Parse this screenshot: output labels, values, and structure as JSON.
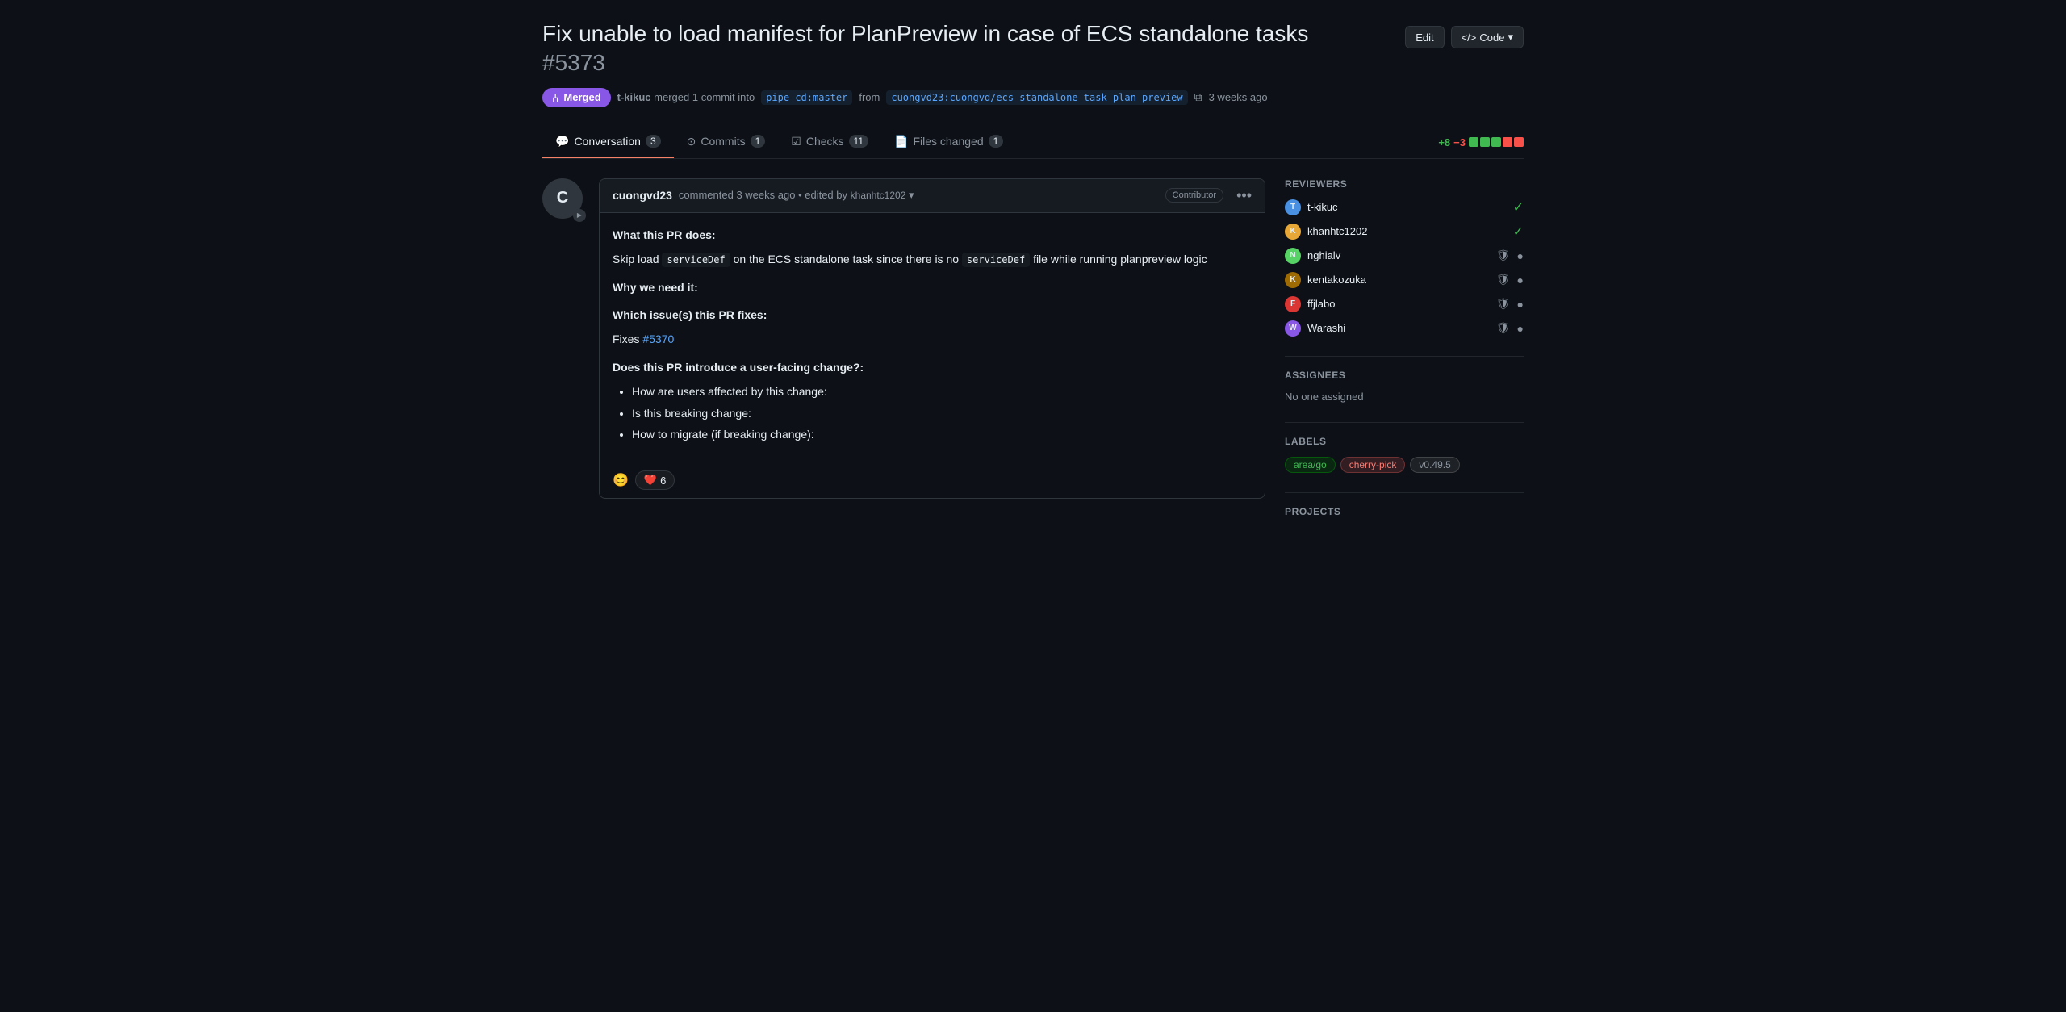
{
  "page": {
    "title": "Fix unable to load manifest for PlanPreview in case of ECS standalone tasks",
    "pr_number": "#5373",
    "merged_badge": "Merged",
    "edit_label": "Edit",
    "code_label": "Code",
    "merged_by": "t-kikuc",
    "merged_action": "merged",
    "commit_count": "1 commit",
    "merged_into": "into",
    "branch_from": "pipe-cd:master",
    "merged_from": "from",
    "branch_head": "cuongvd23:cuongvd/ecs-standalone-task-plan-preview",
    "time_ago": "3 weeks ago"
  },
  "tabs": [
    {
      "id": "conversation",
      "label": "Conversation",
      "count": "3",
      "active": true,
      "icon": "💬"
    },
    {
      "id": "commits",
      "label": "Commits",
      "count": "1",
      "active": false,
      "icon": "⊙"
    },
    {
      "id": "checks",
      "label": "Checks",
      "count": "11",
      "active": false,
      "icon": "☑"
    },
    {
      "id": "files-changed",
      "label": "Files changed",
      "count": "1",
      "active": false,
      "icon": "📄"
    }
  ],
  "diff_stats": {
    "plus": "+8",
    "minus": "−3",
    "squares": [
      "green",
      "green",
      "green",
      "red",
      "red"
    ]
  },
  "comment": {
    "author": "cuongvd23",
    "action": "commented",
    "time_ago": "3 weeks ago",
    "edited_prefix": "• edited by",
    "edited_by": "khanhtc1202",
    "role_badge": "Contributor",
    "body": {
      "section1_title": "What this PR does:",
      "section1_text": "Skip load",
      "code1": "serviceDef",
      "section1_text2": "on the ECS standalone task since there is no",
      "code2": "serviceDef",
      "section1_text3": "file while running planpreview logic",
      "section2_title": "Why we need it:",
      "section3_title": "Which issue(s) this PR fixes:",
      "fixes_text": "Fixes",
      "fixes_link": "#5370",
      "section4_title": "Does this PR introduce a user-facing change?:",
      "bullets": [
        "How are users affected by this change:",
        "Is this breaking change:",
        "How to migrate (if breaking change):"
      ]
    },
    "reactions": {
      "add_icon": "😊",
      "heart_emoji": "❤️",
      "heart_count": "6"
    }
  },
  "sidebar": {
    "reviewers_title": "Reviewers",
    "reviewers": [
      {
        "name": "t-kikuc",
        "status": "approved",
        "shield": false
      },
      {
        "name": "khanhtc1202",
        "status": "approved",
        "shield": false
      },
      {
        "name": "nghialv",
        "status": "pending",
        "shield": true
      },
      {
        "name": "kentakozuka",
        "status": "pending",
        "shield": true
      },
      {
        "name": "ffjlabo",
        "status": "pending",
        "shield": true
      },
      {
        "name": "Warashi",
        "status": "pending",
        "shield": true
      }
    ],
    "assignees_title": "Assignees",
    "no_assignees": "No one assigned",
    "labels_title": "Labels",
    "labels": [
      {
        "text": "area/go",
        "style": "area-go"
      },
      {
        "text": "cherry-pick",
        "style": "cherry-pick"
      },
      {
        "text": "v0.49.5",
        "style": "v0495"
      }
    ],
    "projects_title": "Projects"
  }
}
